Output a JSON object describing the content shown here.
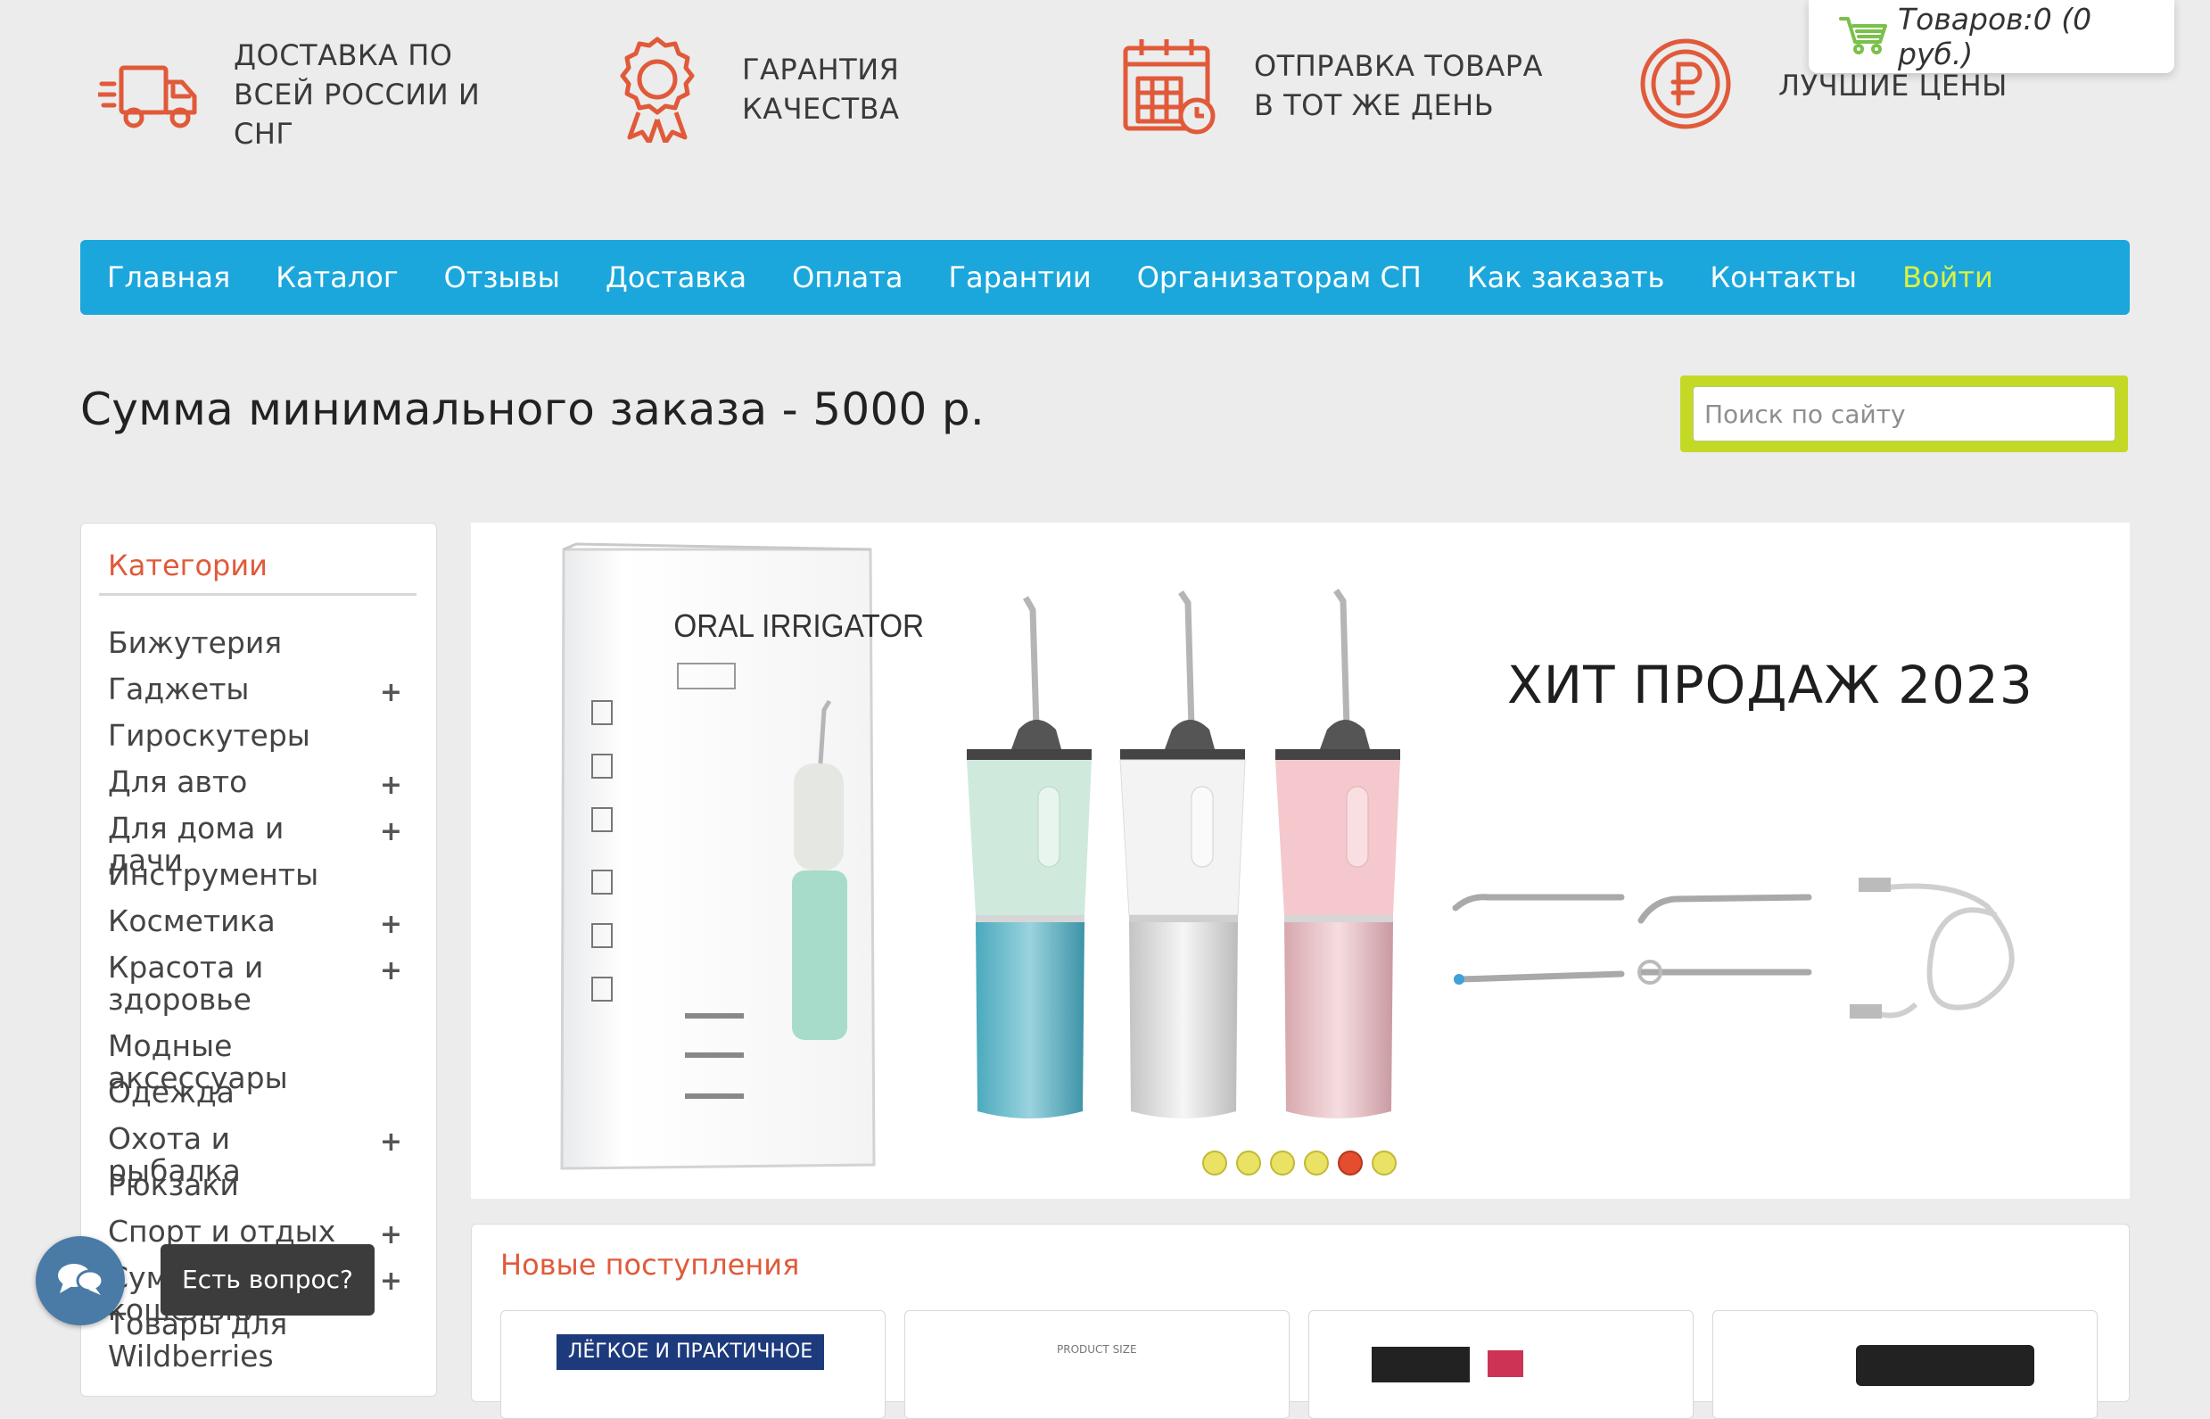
{
  "features": [
    {
      "icon": "delivery-truck-icon",
      "text": "ДОСТАВКА ПО ВСЕЙ РОССИИ И СНГ"
    },
    {
      "icon": "quality-medal-icon",
      "text": "ГАРАНТИЯ КАЧЕСТВА"
    },
    {
      "icon": "calendar-clock-icon",
      "text": "ОТПРАВКА ТОВАРА В ТОТ ЖЕ ДЕНЬ"
    },
    {
      "icon": "ruble-coin-icon",
      "text": "ЛУЧШИЕ ЦЕНЫ"
    }
  ],
  "cart": {
    "label": "Товаров:0 (0 руб.)"
  },
  "nav": {
    "items": [
      "Главная",
      "Каталог",
      "Отзывы",
      "Доставка",
      "Оплата",
      "Гарантии",
      "Организаторам СП",
      "Как заказать",
      "Контакты"
    ],
    "login": "Войти"
  },
  "min_order": "Сумма минимального заказа - 5000 р.",
  "search": {
    "placeholder": "Поиск по сайту"
  },
  "sidebar": {
    "title": "Категории",
    "categories": [
      {
        "name": "Бижутерия",
        "expandable": false
      },
      {
        "name": "Гаджеты",
        "expandable": true
      },
      {
        "name": "Гироскутеры",
        "expandable": false
      },
      {
        "name": "Для авто",
        "expandable": true
      },
      {
        "name": "Для дома и дачи",
        "expandable": true
      },
      {
        "name": "Инструменты",
        "expandable": false
      },
      {
        "name": "Косметика",
        "expandable": true
      },
      {
        "name": "Красота и здоровье",
        "expandable": true
      },
      {
        "name": "Модные аксессуары",
        "expandable": false
      },
      {
        "name": "Одежда",
        "expandable": false
      },
      {
        "name": "Охота и рыбалка",
        "expandable": true
      },
      {
        "name": "Рюкзаки",
        "expandable": false
      },
      {
        "name": "Спорт и отдых",
        "expandable": true
      },
      {
        "name": "Сумки и кошельки",
        "expandable": true
      },
      {
        "name": "Товары для Wildberries",
        "expandable": false
      }
    ],
    "plus_symbol": "+"
  },
  "slider": {
    "box_label": "ORAL IRRIGATOR",
    "headline": "ХИТ ПРОДАЖ 2023",
    "slide_count": 6,
    "active_slide": 5
  },
  "new_arrivals": {
    "title": "Новые поступления",
    "product_banner": "ЛЁГКОЕ И ПРАКТИЧНОЕ",
    "product_small": "PRODUCT SIZE"
  },
  "chat": {
    "tooltip": "Есть вопрос?"
  },
  "colors": {
    "accent_red": "#e05a3a",
    "nav_blue": "#1ca7dc",
    "login_yellow": "#dcf043",
    "search_green": "#c3d925"
  }
}
